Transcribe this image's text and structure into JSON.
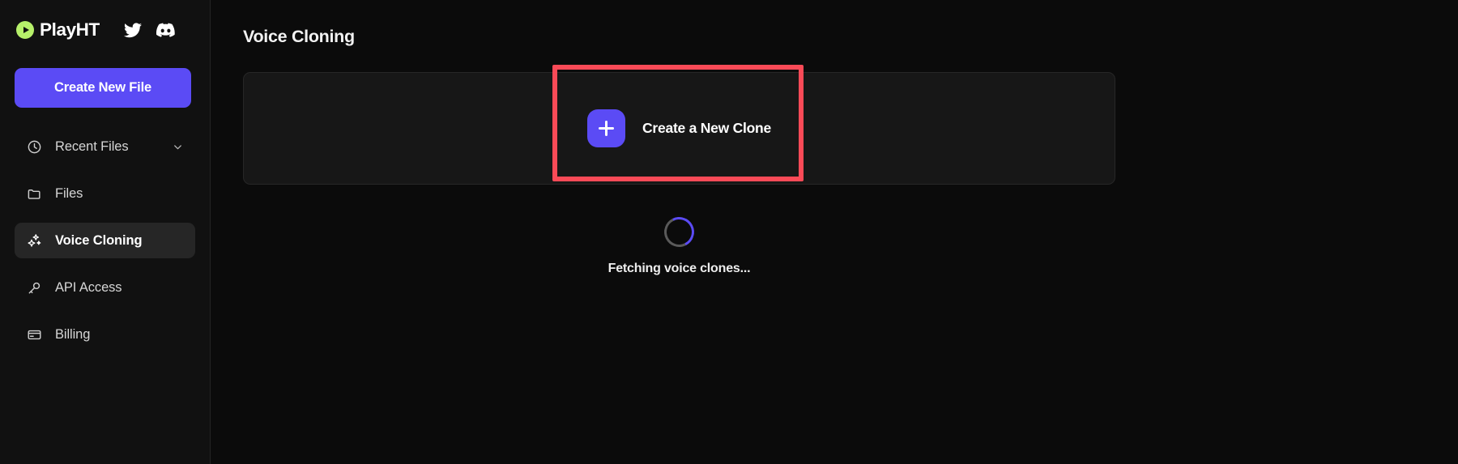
{
  "brand": {
    "name": "PlayHT",
    "logo_icon": "play-circle-icon",
    "logo_color": "#b6f06a",
    "socials": [
      {
        "icon": "twitter-icon",
        "label": "Twitter"
      },
      {
        "icon": "discord-icon",
        "label": "Discord"
      }
    ]
  },
  "sidebar": {
    "primary_action": {
      "label": "Create New File",
      "color": "#5b4bf5"
    },
    "items": [
      {
        "label": "Recent Files",
        "icon": "clock-icon",
        "active": false,
        "has_chevron": true,
        "chevron_icon": "chevron-down-icon"
      },
      {
        "label": "Files",
        "icon": "folder-icon",
        "active": false,
        "has_chevron": false
      },
      {
        "label": "Voice Cloning",
        "icon": "sparkles-icon",
        "active": true,
        "has_chevron": false
      },
      {
        "label": "API Access",
        "icon": "key-icon",
        "active": false,
        "has_chevron": false
      },
      {
        "label": "Billing",
        "icon": "credit-card-icon",
        "active": false,
        "has_chevron": false
      }
    ]
  },
  "main": {
    "page_title": "Voice Cloning",
    "create_clone": {
      "label": "Create a New Clone",
      "icon": "plus-icon",
      "tile_color": "#5b4bf5"
    },
    "loading": {
      "text": "Fetching voice clones...",
      "spinner_icon": "spinner-icon",
      "spinner_accent": "#5b4bf5",
      "spinner_track": "#5a5a5a"
    }
  },
  "annotation": {
    "type": "highlight-rectangle",
    "color": "#fa4a57",
    "targets": "create-a-new-clone-button"
  }
}
